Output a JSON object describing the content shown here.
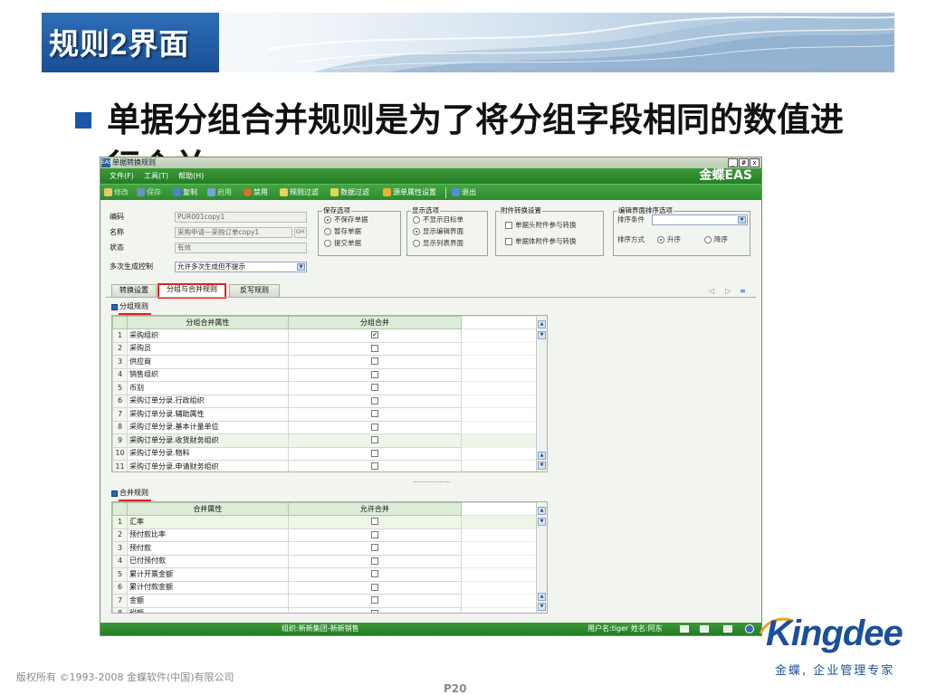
{
  "slide": {
    "title": "规则2界面",
    "bullet": "单据分组合并规则是为了将分组字段相同的数值进",
    "bullet_cont": "行合并",
    "copyright": "版权所有 ©1993-2008 金蝶软件(中国)有限公司",
    "page": "P20",
    "logo": "Kingdee",
    "logo_tagline": "金蝶, 企业管理专家"
  },
  "window": {
    "app_icon": "EAS",
    "title": "单据转换规则",
    "brand": "金蝶EAS",
    "buttons": [
      "_",
      "#",
      "x"
    ]
  },
  "menu": [
    "文件(F)",
    "工具(T)",
    "帮助(H)"
  ],
  "toolbar": [
    "修改",
    "保存",
    "复制",
    "启用",
    "禁用",
    "规则过滤",
    "数据过滤",
    "源单属性设置",
    "退出"
  ],
  "form": {
    "code_label": "编码",
    "code_value": "PUR001copy1",
    "name_label": "名称",
    "name_value": "采购申请—采购订单copy1",
    "name_btn": "GH",
    "status_label": "状态",
    "status_value": "有效",
    "multi_label": "多次生成控制",
    "multi_value": "允许多次生成但不提示"
  },
  "save_group": {
    "title": "保存选项",
    "options": [
      "不保存单据",
      "暂存单据",
      "提交单据"
    ]
  },
  "display_group": {
    "title": "显示选项",
    "options": [
      "不显示目标单",
      "显示编辑界面",
      "显示列表界面"
    ]
  },
  "attach_group": {
    "title": "附件转换设置",
    "options": [
      "单据头附件参与转换",
      "单据体附件参与转换"
    ]
  },
  "sort_group": {
    "title": "编辑界面排序选项",
    "cond_label": "排序条件",
    "order_label": "排序方式",
    "asc": "升序",
    "desc": "降序"
  },
  "tabs": [
    "转换设置",
    "分组与合并规则",
    "反写规则"
  ],
  "tab_nav": [
    "◁",
    "▷",
    "≡"
  ],
  "group_rules": {
    "title": "分组规则",
    "col1": "分组合并属性",
    "col2": "分组合并",
    "rows": [
      {
        "n": "1",
        "name": "采购组织"
      },
      {
        "n": "2",
        "name": "采购员"
      },
      {
        "n": "3",
        "name": "供应商"
      },
      {
        "n": "4",
        "name": "销售组织"
      },
      {
        "n": "5",
        "name": "币别"
      },
      {
        "n": "6",
        "name": "采购订单分录.行政组织"
      },
      {
        "n": "7",
        "name": "采购订单分录.辅助属性"
      },
      {
        "n": "8",
        "name": "采购订单分录.基本计量单位"
      },
      {
        "n": "9",
        "name": "采购订单分录.收货财务组织"
      },
      {
        "n": "10",
        "name": "采购订单分录.物料"
      },
      {
        "n": "11",
        "name": "采购订单分录.申请财务组织"
      }
    ]
  },
  "merge_rules": {
    "title": "合并规则",
    "col1": "合并属性",
    "col2": "允许合并",
    "rows": [
      {
        "n": "1",
        "name": "汇率"
      },
      {
        "n": "2",
        "name": "预付款比率"
      },
      {
        "n": "3",
        "name": "预付款"
      },
      {
        "n": "4",
        "name": "已付预付款"
      },
      {
        "n": "5",
        "name": "累计开票金额"
      },
      {
        "n": "6",
        "name": "累计付款金额"
      },
      {
        "n": "7",
        "name": "金额"
      },
      {
        "n": "8",
        "name": "税额"
      }
    ]
  },
  "status_bar": {
    "org": "组织:新新集团-新新销售",
    "user": "用户名:tiger 姓名:阿东"
  }
}
